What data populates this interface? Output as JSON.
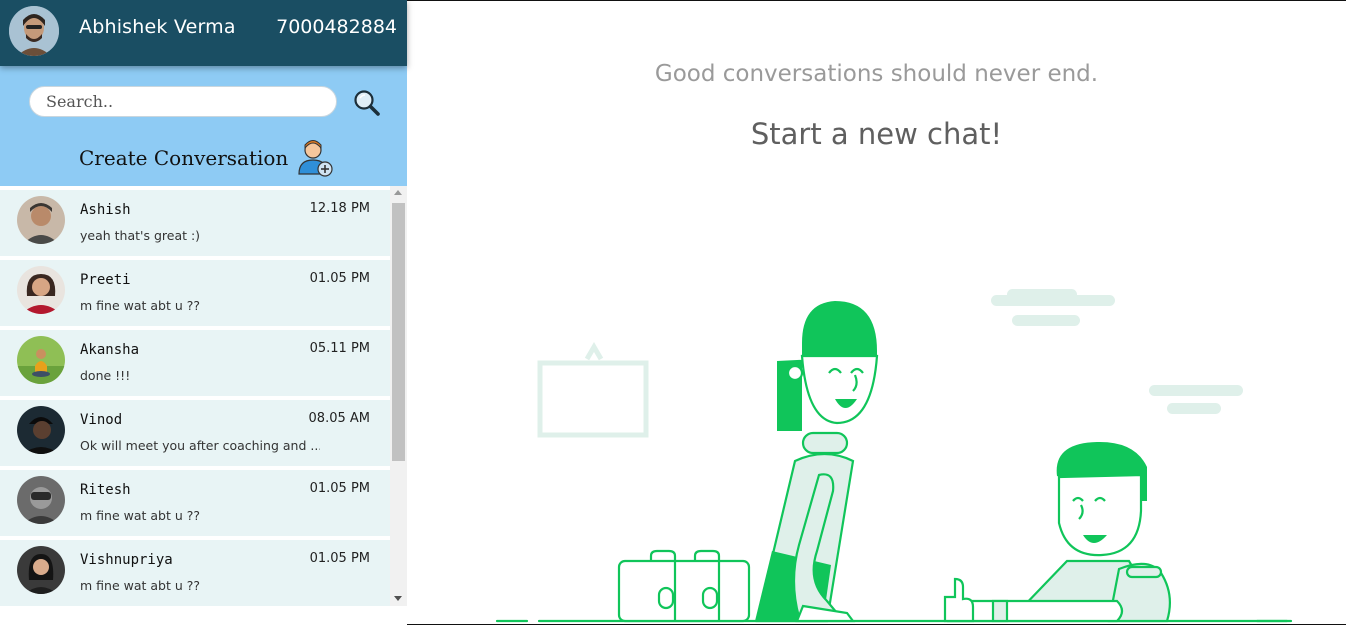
{
  "header": {
    "user_name": "Abhishek Verma",
    "phone": "7000482884"
  },
  "search": {
    "placeholder": "Search.."
  },
  "create": {
    "label": "Create Conversation"
  },
  "conversations": [
    {
      "name": "Ashish",
      "time": "12.18 PM",
      "message": "yeah that's great :)"
    },
    {
      "name": "Preeti",
      "time": "01.05 PM",
      "message": "m fine wat abt u ??"
    },
    {
      "name": "Akansha",
      "time": "05.11 PM",
      "message": "done !!!"
    },
    {
      "name": "Vinod",
      "time": "08.05 AM",
      "message": "Ok will meet you after coaching and ..."
    },
    {
      "name": "Ritesh",
      "time": "01.05 PM",
      "message": "m fine wat abt u ??"
    },
    {
      "name": "Vishnupriya",
      "time": "01.05 PM",
      "message": "m fine wat abt u ??"
    }
  ],
  "welcome": {
    "tagline": "Good conversations should never end.",
    "cta": "Start a new chat!"
  },
  "colors": {
    "header_bg": "#1a4e63",
    "search_area_bg": "#8ecbf4",
    "conversation_bg": "#e8f4f5",
    "illustration_green": "#10c55a"
  }
}
